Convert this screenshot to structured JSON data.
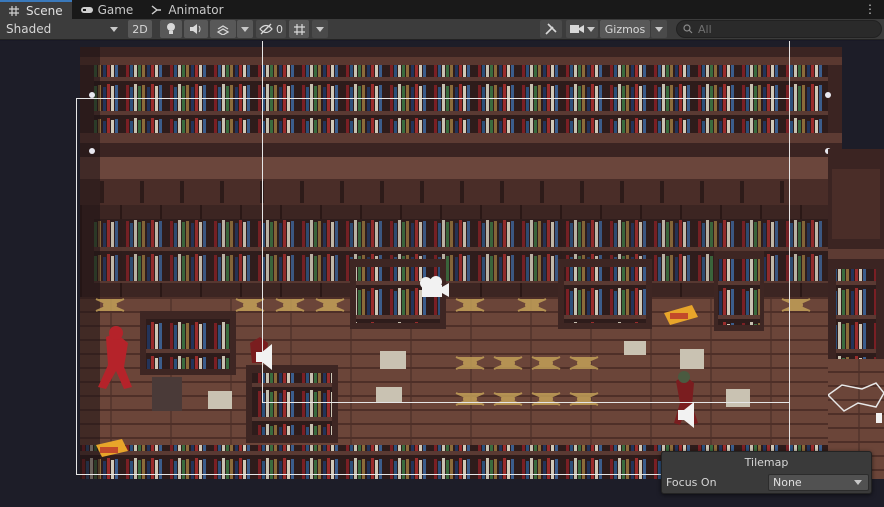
{
  "tabs": [
    {
      "label": "Scene",
      "icon": "grid-icon",
      "active": true
    },
    {
      "label": "Game",
      "icon": "gamepad-icon",
      "active": false
    },
    {
      "label": "Animator",
      "icon": "animator-icon",
      "active": false
    }
  ],
  "toolbar": {
    "shading_mode": "Shaded",
    "mode_2d_label": "2D",
    "hidden_count": "0",
    "gizmos_label": "Gizmos",
    "search_placeholder": "All"
  },
  "tilemap_overlay": {
    "title": "Tilemap",
    "focus_label": "Focus On",
    "focus_value": "None"
  },
  "colors": {
    "accent": "#3a79bb",
    "toolbar_bg": "#3c3c3c",
    "scene_bg": "#1d1d28",
    "wood_dark": "#3a2320",
    "wood_mid": "#5a3a33",
    "floor": "#6e4a3e"
  }
}
